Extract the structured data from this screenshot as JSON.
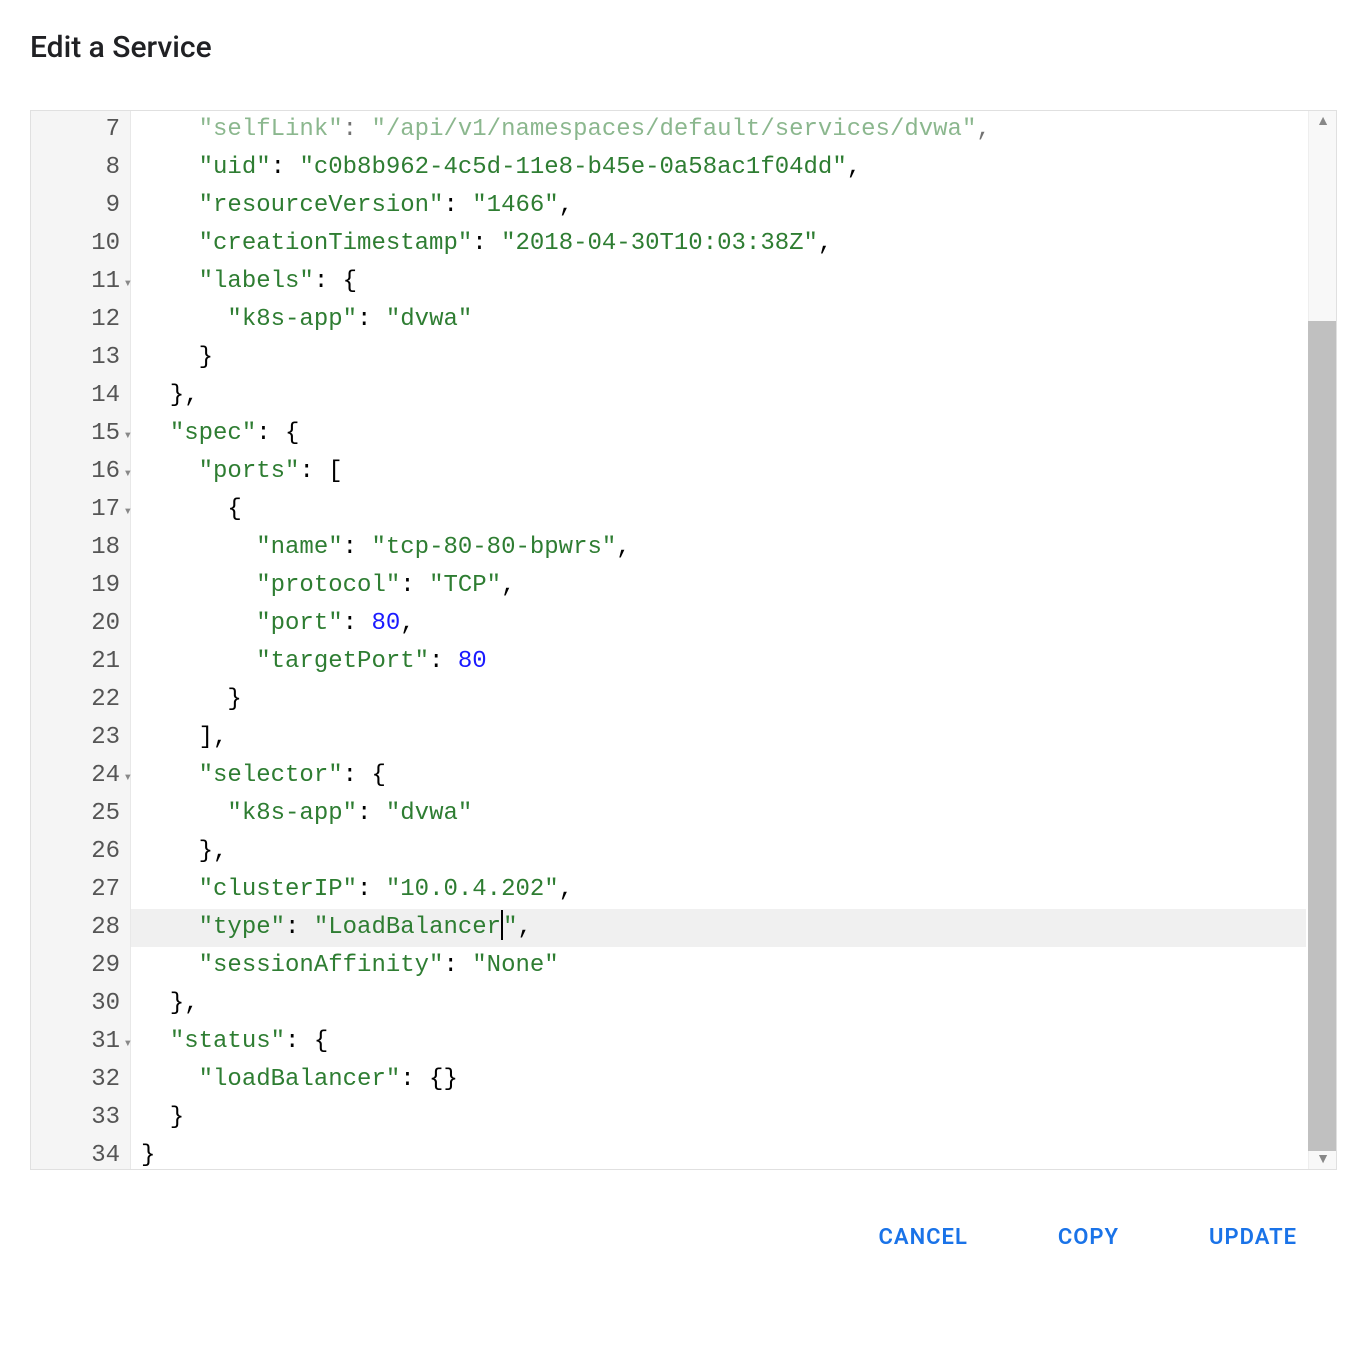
{
  "dialog": {
    "title": "Edit a Service"
  },
  "actions": {
    "cancel": "CANCEL",
    "copy": "COPY",
    "update": "UPDATE"
  },
  "editor": {
    "startLine": 7,
    "highlightLine": 28,
    "cursorLine": 28,
    "lines": [
      {
        "num": 7,
        "fold": false,
        "tokens": [
          [
            "    ",
            "p"
          ],
          [
            "\"selfLink\"",
            "k"
          ],
          [
            ": ",
            "p"
          ],
          [
            "\"/api/v1/namespaces/default/services/dvwa\"",
            "s"
          ],
          [
            ",",
            "p"
          ]
        ],
        "fade": true
      },
      {
        "num": 8,
        "fold": false,
        "tokens": [
          [
            "    ",
            "p"
          ],
          [
            "\"uid\"",
            "k"
          ],
          [
            ": ",
            "p"
          ],
          [
            "\"c0b8b962-4c5d-11e8-b45e-0a58ac1f04dd\"",
            "s"
          ],
          [
            ",",
            "p"
          ]
        ]
      },
      {
        "num": 9,
        "fold": false,
        "tokens": [
          [
            "    ",
            "p"
          ],
          [
            "\"resourceVersion\"",
            "k"
          ],
          [
            ": ",
            "p"
          ],
          [
            "\"1466\"",
            "s"
          ],
          [
            ",",
            "p"
          ]
        ]
      },
      {
        "num": 10,
        "fold": false,
        "tokens": [
          [
            "    ",
            "p"
          ],
          [
            "\"creationTimestamp\"",
            "k"
          ],
          [
            ": ",
            "p"
          ],
          [
            "\"2018-04-30T10:03:38Z\"",
            "s"
          ],
          [
            ",",
            "p"
          ]
        ]
      },
      {
        "num": 11,
        "fold": true,
        "tokens": [
          [
            "    ",
            "p"
          ],
          [
            "\"labels\"",
            "k"
          ],
          [
            ": {",
            "p"
          ]
        ]
      },
      {
        "num": 12,
        "fold": false,
        "tokens": [
          [
            "      ",
            "p"
          ],
          [
            "\"k8s-app\"",
            "k"
          ],
          [
            ": ",
            "p"
          ],
          [
            "\"dvwa\"",
            "s"
          ]
        ]
      },
      {
        "num": 13,
        "fold": false,
        "tokens": [
          [
            "    }",
            "p"
          ]
        ]
      },
      {
        "num": 14,
        "fold": false,
        "tokens": [
          [
            "  },",
            "p"
          ]
        ]
      },
      {
        "num": 15,
        "fold": true,
        "tokens": [
          [
            "  ",
            "p"
          ],
          [
            "\"spec\"",
            "k"
          ],
          [
            ": {",
            "p"
          ]
        ]
      },
      {
        "num": 16,
        "fold": true,
        "tokens": [
          [
            "    ",
            "p"
          ],
          [
            "\"ports\"",
            "k"
          ],
          [
            ": [",
            "p"
          ]
        ]
      },
      {
        "num": 17,
        "fold": true,
        "tokens": [
          [
            "      {",
            "p"
          ]
        ]
      },
      {
        "num": 18,
        "fold": false,
        "tokens": [
          [
            "        ",
            "p"
          ],
          [
            "\"name\"",
            "k"
          ],
          [
            ": ",
            "p"
          ],
          [
            "\"tcp-80-80-bpwrs\"",
            "s"
          ],
          [
            ",",
            "p"
          ]
        ]
      },
      {
        "num": 19,
        "fold": false,
        "tokens": [
          [
            "        ",
            "p"
          ],
          [
            "\"protocol\"",
            "k"
          ],
          [
            ": ",
            "p"
          ],
          [
            "\"TCP\"",
            "s"
          ],
          [
            ",",
            "p"
          ]
        ]
      },
      {
        "num": 20,
        "fold": false,
        "tokens": [
          [
            "        ",
            "p"
          ],
          [
            "\"port\"",
            "k"
          ],
          [
            ": ",
            "p"
          ],
          [
            "80",
            "n"
          ],
          [
            ",",
            "p"
          ]
        ]
      },
      {
        "num": 21,
        "fold": false,
        "tokens": [
          [
            "        ",
            "p"
          ],
          [
            "\"targetPort\"",
            "k"
          ],
          [
            ": ",
            "p"
          ],
          [
            "80",
            "n"
          ]
        ]
      },
      {
        "num": 22,
        "fold": false,
        "tokens": [
          [
            "      }",
            "p"
          ]
        ]
      },
      {
        "num": 23,
        "fold": false,
        "tokens": [
          [
            "    ],",
            "p"
          ]
        ]
      },
      {
        "num": 24,
        "fold": true,
        "tokens": [
          [
            "    ",
            "p"
          ],
          [
            "\"selector\"",
            "k"
          ],
          [
            ": {",
            "p"
          ]
        ]
      },
      {
        "num": 25,
        "fold": false,
        "tokens": [
          [
            "      ",
            "p"
          ],
          [
            "\"k8s-app\"",
            "k"
          ],
          [
            ": ",
            "p"
          ],
          [
            "\"dvwa\"",
            "s"
          ]
        ]
      },
      {
        "num": 26,
        "fold": false,
        "tokens": [
          [
            "    },",
            "p"
          ]
        ]
      },
      {
        "num": 27,
        "fold": false,
        "tokens": [
          [
            "    ",
            "p"
          ],
          [
            "\"clusterIP\"",
            "k"
          ],
          [
            ": ",
            "p"
          ],
          [
            "\"10.0.4.202\"",
            "s"
          ],
          [
            ",",
            "p"
          ]
        ]
      },
      {
        "num": 28,
        "fold": false,
        "tokens": [
          [
            "    ",
            "p"
          ],
          [
            "\"type\"",
            "k"
          ],
          [
            ": ",
            "p"
          ],
          [
            "\"LoadBalancer",
            "s"
          ],
          [
            "|",
            "cur"
          ],
          [
            "\"",
            "s"
          ],
          [
            ",",
            "p"
          ]
        ]
      },
      {
        "num": 29,
        "fold": false,
        "tokens": [
          [
            "    ",
            "p"
          ],
          [
            "\"sessionAffinity\"",
            "k"
          ],
          [
            ": ",
            "p"
          ],
          [
            "\"None\"",
            "s"
          ]
        ]
      },
      {
        "num": 30,
        "fold": false,
        "tokens": [
          [
            "  },",
            "p"
          ]
        ]
      },
      {
        "num": 31,
        "fold": true,
        "tokens": [
          [
            "  ",
            "p"
          ],
          [
            "\"status\"",
            "k"
          ],
          [
            ": {",
            "p"
          ]
        ]
      },
      {
        "num": 32,
        "fold": false,
        "tokens": [
          [
            "    ",
            "p"
          ],
          [
            "\"loadBalancer\"",
            "k"
          ],
          [
            ": {}",
            "p"
          ]
        ]
      },
      {
        "num": 33,
        "fold": false,
        "tokens": [
          [
            "  }",
            "p"
          ]
        ]
      },
      {
        "num": 34,
        "fold": false,
        "tokens": [
          [
            "}",
            "p"
          ]
        ]
      }
    ],
    "scrollbar": {
      "thumbTop": 210,
      "thumbHeight": 830
    }
  }
}
